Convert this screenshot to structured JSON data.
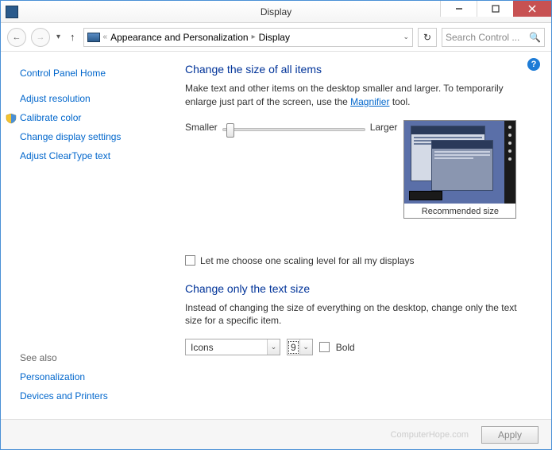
{
  "window": {
    "title": "Display"
  },
  "breadcrumb": {
    "item1": "Appearance and Personalization",
    "item2": "Display"
  },
  "search": {
    "placeholder": "Search Control ..."
  },
  "sidebar": {
    "home": "Control Panel Home",
    "links": {
      "resolution": "Adjust resolution",
      "calibrate": "Calibrate color",
      "display_settings": "Change display settings",
      "cleartype": "Adjust ClearType text"
    },
    "see_also_heading": "See also",
    "see_also": {
      "personalization": "Personalization",
      "devices": "Devices and Printers"
    }
  },
  "main": {
    "heading1": "Change the size of all items",
    "desc1_a": "Make text and other items on the desktop smaller and larger. To temporarily enlarge just part of the screen, use the ",
    "desc1_link": "Magnifier",
    "desc1_b": " tool.",
    "slider_smaller": "Smaller",
    "slider_larger": "Larger",
    "preview_caption": "Recommended size",
    "checkbox_label": "Let me choose one scaling level for all my displays",
    "heading2": "Change only the text size",
    "desc2": "Instead of changing the size of everything on the desktop, change only the text size for a specific item.",
    "item_dropdown": "Icons",
    "size_dropdown": "9",
    "bold_label": "Bold"
  },
  "footer": {
    "watermark": "ComputerHope.com",
    "apply": "Apply"
  }
}
